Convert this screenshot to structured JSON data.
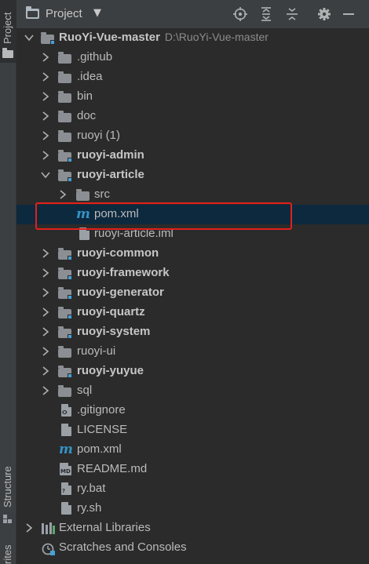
{
  "side_strip": {
    "project_tab": "Project",
    "structure_tab": "Structure",
    "favorites_tab": "rites"
  },
  "header": {
    "title": "Project",
    "caret": "▼",
    "buttons": [
      "locate-icon",
      "expand-all-icon",
      "collapse-all-icon",
      "gear-icon",
      "minimize-icon"
    ]
  },
  "tree": {
    "root": {
      "label": "RuoYi-Vue-master",
      "path": "D:\\RuoYi-Vue-master"
    },
    "items": [
      {
        "label": ".github",
        "kind": "folder"
      },
      {
        "label": ".idea",
        "kind": "folder"
      },
      {
        "label": "bin",
        "kind": "folder"
      },
      {
        "label": "doc",
        "kind": "folder"
      },
      {
        "label": "ruoyi (1)",
        "kind": "folder"
      },
      {
        "label": "ruoyi-admin",
        "kind": "module"
      },
      {
        "label": "ruoyi-article",
        "kind": "module",
        "expanded": true
      },
      {
        "label": "src",
        "kind": "folder",
        "level": 2
      },
      {
        "label": "pom.xml",
        "kind": "maven",
        "level": 2,
        "selected": true
      },
      {
        "label": "ruoyi-article.iml",
        "kind": "iml",
        "level": 2
      },
      {
        "label": "ruoyi-common",
        "kind": "module"
      },
      {
        "label": "ruoyi-framework",
        "kind": "module"
      },
      {
        "label": "ruoyi-generator",
        "kind": "module"
      },
      {
        "label": "ruoyi-quartz",
        "kind": "module"
      },
      {
        "label": "ruoyi-system",
        "kind": "module"
      },
      {
        "label": "ruoyi-ui",
        "kind": "folder"
      },
      {
        "label": "ruoyi-yuyue",
        "kind": "module"
      },
      {
        "label": "sql",
        "kind": "folder"
      },
      {
        "label": ".gitignore",
        "kind": "file"
      },
      {
        "label": "LICENSE",
        "kind": "file"
      },
      {
        "label": "pom.xml",
        "kind": "maven"
      },
      {
        "label": "README.md",
        "kind": "md"
      },
      {
        "label": "ry.bat",
        "kind": "file"
      },
      {
        "label": "ry.sh",
        "kind": "file"
      }
    ],
    "external_libraries": "External Libraries",
    "scratches": "Scratches and Consoles"
  },
  "colors": {
    "selection": "#0d293e",
    "highlight_border": "#e3201b",
    "maven_blue": "#3592c4"
  }
}
